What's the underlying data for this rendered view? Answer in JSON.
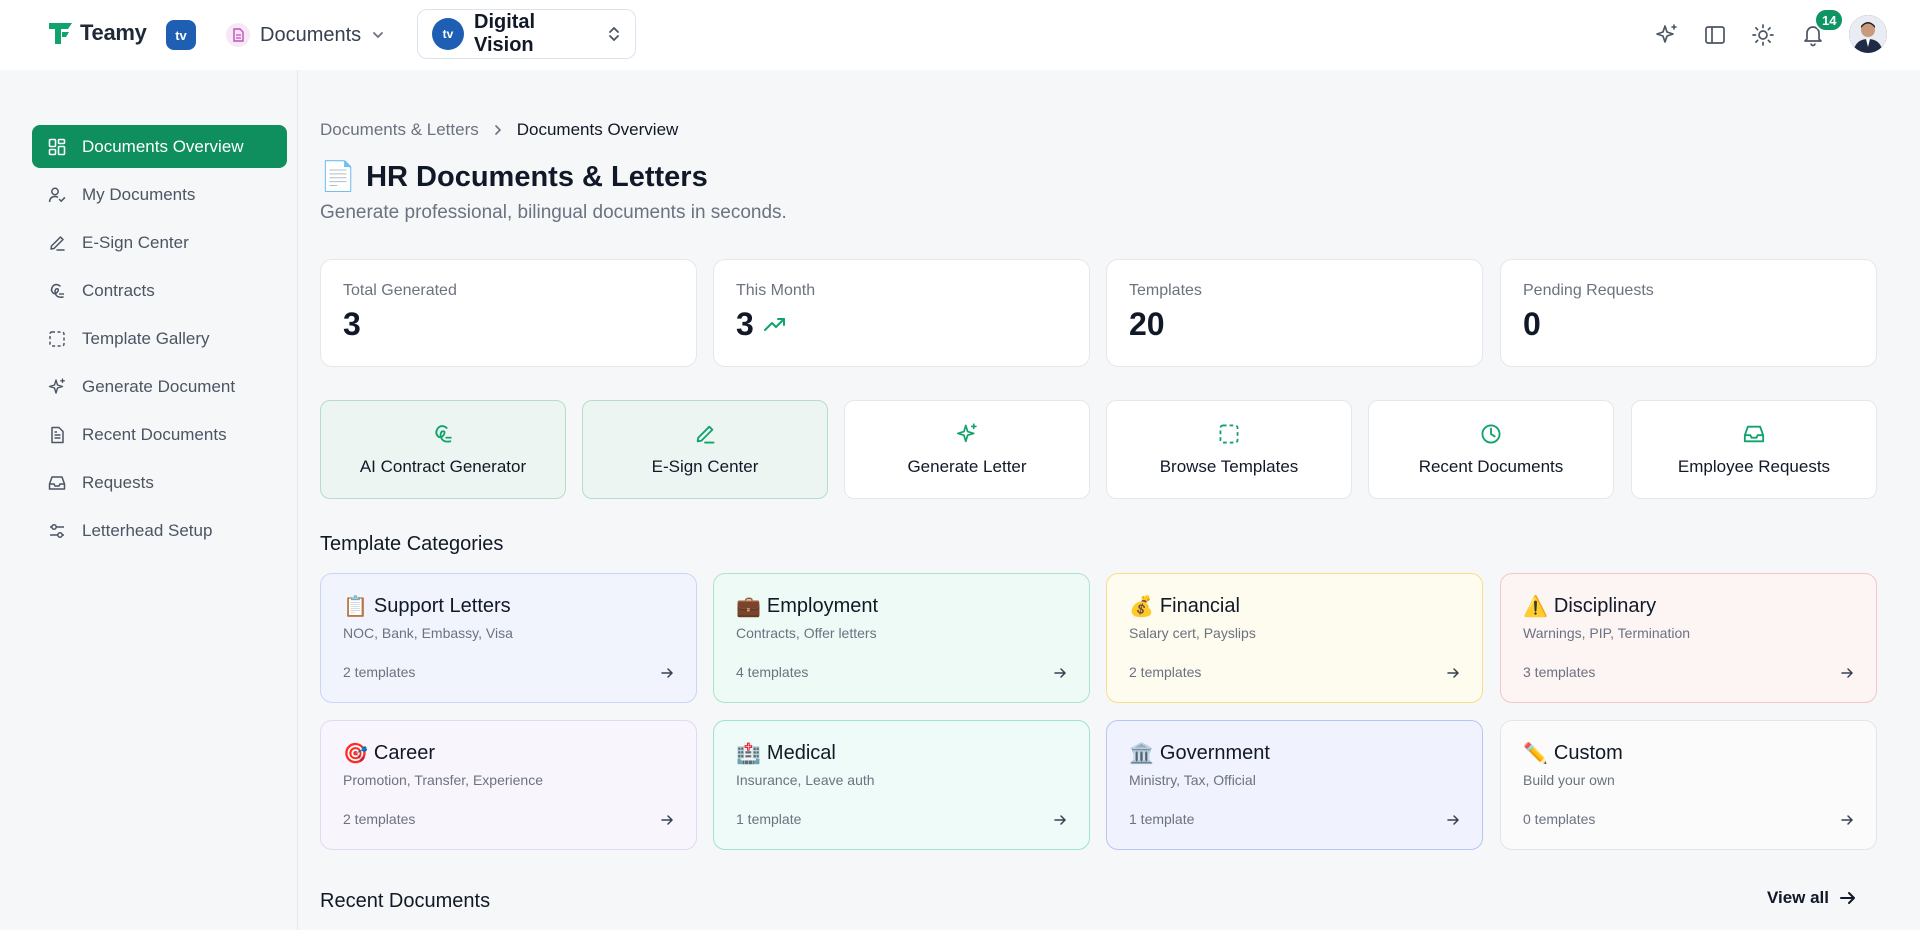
{
  "topbar": {
    "logo_text": "Teamy",
    "org_badge": "tv",
    "module": "Documents",
    "company": "Digital Vision",
    "company_logo": "tv",
    "notifications_count": "14",
    "icons": [
      "sparkles-icon",
      "sidebar-toggle-icon",
      "sun-icon",
      "bell-icon"
    ]
  },
  "sidebar": {
    "items": [
      {
        "label": "Documents Overview",
        "icon": "grid-icon",
        "active": true
      },
      {
        "label": "My Documents",
        "icon": "user-check-icon"
      },
      {
        "label": "E-Sign Center",
        "icon": "pen-icon"
      },
      {
        "label": "Contracts",
        "icon": "signature-icon"
      },
      {
        "label": "Template Gallery",
        "icon": "dashed-square-icon"
      },
      {
        "label": "Generate Document",
        "icon": "sparkles-icon"
      },
      {
        "label": "Recent Documents",
        "icon": "file-text-icon"
      },
      {
        "label": "Requests",
        "icon": "inbox-icon"
      },
      {
        "label": "Letterhead Setup",
        "icon": "sliders-icon"
      }
    ]
  },
  "breadcrumb": {
    "parent": "Documents & Letters",
    "current": "Documents Overview"
  },
  "header": {
    "emoji": "📄",
    "title": "HR Documents & Letters",
    "subtitle": "Generate professional, bilingual documents in seconds."
  },
  "stats": [
    {
      "label": "Total Generated",
      "value": "3"
    },
    {
      "label": "This Month",
      "value": "3",
      "trend_icon": "trending-up-icon"
    },
    {
      "label": "Templates",
      "value": "20"
    },
    {
      "label": "Pending Requests",
      "value": "0"
    }
  ],
  "quick_actions": [
    {
      "label": "AI Contract Generator",
      "icon": "signature-icon"
    },
    {
      "label": "E-Sign Center",
      "icon": "pen-icon"
    },
    {
      "label": "Generate Letter",
      "icon": "sparkles-icon"
    },
    {
      "label": "Browse Templates",
      "icon": "dashed-square-icon"
    },
    {
      "label": "Recent Documents",
      "icon": "clock-icon"
    },
    {
      "label": "Employee Requests",
      "icon": "inbox-icon"
    }
  ],
  "categories_title": "Template Categories",
  "categories": [
    {
      "emoji": "📋",
      "title": "Support Letters",
      "desc": "NOC, Bank, Embassy, Visa",
      "count": "2 templates",
      "bg": "#f1f4fd",
      "border": "#c9d5f7"
    },
    {
      "emoji": "💼",
      "title": "Employment",
      "desc": "Contracts, Offer letters",
      "count": "4 templates",
      "bg": "#eefaf5",
      "border": "#a9e6c9"
    },
    {
      "emoji": "💰",
      "title": "Financial",
      "desc": "Salary cert, Payslips",
      "count": "2 templates",
      "bg": "#fefbef",
      "border": "#f6df8c"
    },
    {
      "emoji": "⚠️",
      "title": "Disciplinary",
      "desc": "Warnings, PIP, Termination",
      "count": "3 templates",
      "bg": "#fdf4f4",
      "border": "#f4c6c6"
    },
    {
      "emoji": "🎯",
      "title": "Career",
      "desc": "Promotion, Transfer, Experience",
      "count": "2 templates",
      "bg": "#f9f5fd",
      "border": "#e6d7f3"
    },
    {
      "emoji": "🏥",
      "title": "Medical",
      "desc": "Insurance, Leave auth",
      "count": "1 template",
      "bg": "#effbf8",
      "border": "#9fe3cd"
    },
    {
      "emoji": "🏛️",
      "title": "Government",
      "desc": "Ministry, Tax, Official",
      "count": "1 template",
      "bg": "#f0f3fd",
      "border": "#b7c6f2"
    },
    {
      "emoji": "✏️",
      "title": "Custom",
      "desc": "Build your own",
      "count": "0 templates",
      "bg": "#fbfbfc",
      "border": "#e3e5e9"
    }
  ],
  "recent_title": "Recent Documents",
  "view_all": "View all",
  "colors": {
    "accent": "#0e8f5d",
    "badge": "#0e9563",
    "org": "#1e5fb4"
  }
}
